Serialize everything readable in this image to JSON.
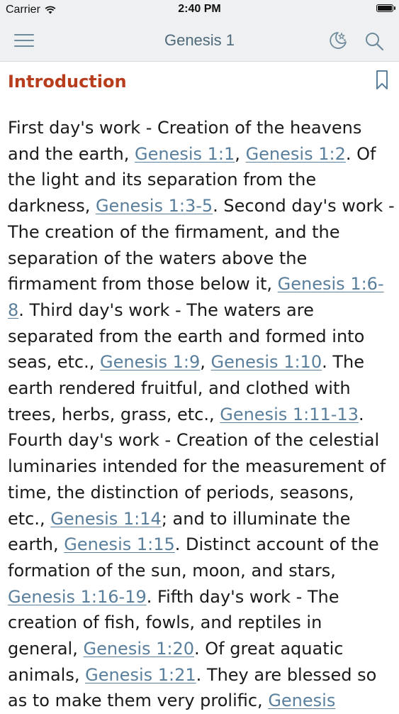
{
  "status": {
    "carrier": "Carrier",
    "time": "2:40 PM"
  },
  "nav": {
    "title": "Genesis 1",
    "icons": [
      "menu-icon",
      "night-mode-icon",
      "search-icon"
    ]
  },
  "section": {
    "heading": "Introduction",
    "icon": "bookmark-icon"
  },
  "colors": {
    "heading": "#b73d1c",
    "link": "#5a7f9c",
    "nav_title": "#4f6a7a",
    "bar_bg": "#eef0f1"
  },
  "body": {
    "t0": "First day's work - Creation of the heavens and the earth, ",
    "r1": "Genesis 1:1",
    "t1": ", ",
    "r2": "Genesis 1:2",
    "t2": ". Of the light and its separation from the darkness, ",
    "r3": "Genesis 1:3-5",
    "t3": ". Second day's work - The creation of the firmament, and the separation of the waters above the firmament from those below it, ",
    "r4": "Genesis 1:6-8",
    "t4": ". Third day's work - The waters are separated from the earth and formed into seas, etc., ",
    "r5": "Genesis 1:9",
    "t5": ", ",
    "r6": "Genesis 1:10",
    "t6": ". The earth rendered fruitful, and clothed with trees, herbs, grass, etc., ",
    "r7": "Genesis 1:11-13",
    "t7": ". Fourth day's work - Creation of the celestial luminaries intended for the measurement of time, the distinction of periods, seasons, etc., ",
    "r8": "Genesis 1:14",
    "t8": "; and to illuminate the earth, ",
    "r9": "Genesis 1:15",
    "t9": ". Distinct account of the formation of the sun, moon, and stars, ",
    "r10": "Genesis 1:16-19",
    "t10": ". Fifth day's work - The creation of fish, fowls, and reptiles in general, ",
    "r11": "Genesis 1:20",
    "t11": ". Of great aquatic animals, ",
    "r12": "Genesis 1:21",
    "t12": ". They are blessed so as to make them very prolific, ",
    "r13": "Genesis"
  }
}
